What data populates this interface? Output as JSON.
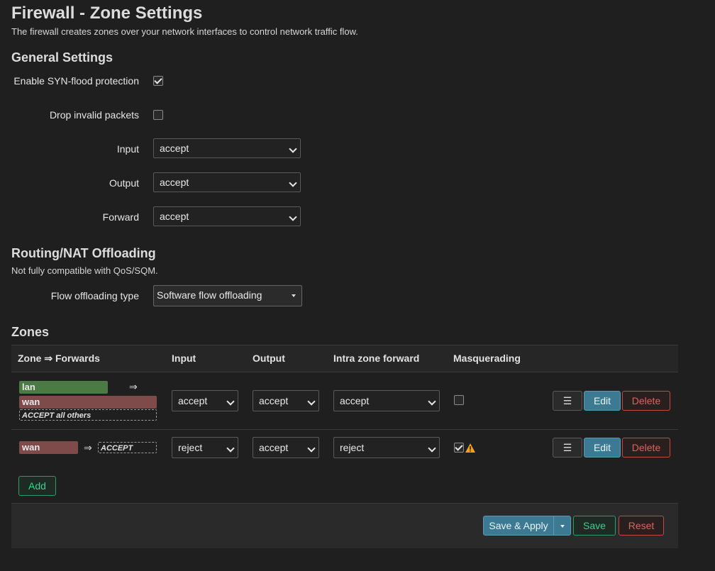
{
  "header": {
    "title": "Firewall - Zone Settings",
    "description": "The firewall creates zones over your network interfaces to control network traffic flow."
  },
  "general": {
    "heading": "General Settings",
    "syn_flood": {
      "label": "Enable SYN-flood protection",
      "checked": true
    },
    "drop_invalid": {
      "label": "Drop invalid packets",
      "checked": false
    },
    "input": {
      "label": "Input",
      "value": "accept"
    },
    "output": {
      "label": "Output",
      "value": "accept"
    },
    "forward": {
      "label": "Forward",
      "value": "accept"
    }
  },
  "offload": {
    "heading": "Routing/NAT Offloading",
    "note": "Not fully compatible with QoS/SQM.",
    "type_label": "Flow offloading type",
    "type_value": "Software flow offloading"
  },
  "zones": {
    "heading": "Zones",
    "columns": [
      "Zone ⇒ Forwards",
      "Input",
      "Output",
      "Intra zone forward",
      "Masquerading"
    ],
    "rows": [
      {
        "zone": "lan",
        "arrow": "⇒",
        "forward_target": "wan",
        "forward_extra": "ACCEPT all others",
        "input": "accept",
        "output": "accept",
        "intra": "accept",
        "masq": false
      },
      {
        "zone": "wan",
        "arrow": "⇒",
        "forward_extra": "ACCEPT",
        "input": "reject",
        "output": "accept",
        "intra": "reject",
        "masq": true
      }
    ],
    "menu_icon": "☰",
    "edit_label": "Edit",
    "delete_label": "Delete",
    "add_label": "Add"
  },
  "footer": {
    "save_apply_label": "Save & Apply",
    "save_label": "Save",
    "reset_label": "Reset"
  },
  "colors": {
    "lan": "#4c7a45",
    "wan": "#7f4a4a",
    "primary": "#3c7a93",
    "positive": "#3fcf8e",
    "negative": "#e06060"
  }
}
